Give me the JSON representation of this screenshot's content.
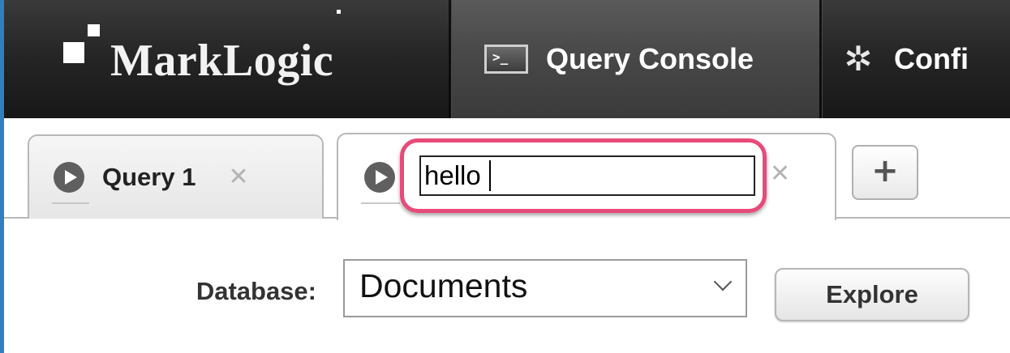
{
  "header": {
    "logo_text": "MarkLogic",
    "nav": [
      {
        "label": "Query Console",
        "icon": "console-icon",
        "active": true
      },
      {
        "label": "Confi",
        "icon": "gear-icon",
        "active": false
      }
    ]
  },
  "tabs": {
    "items": [
      {
        "label": "Query 1",
        "active": false
      },
      {
        "label": "",
        "active": true,
        "editing": true
      }
    ],
    "rename_value": "hello",
    "add_label": "+"
  },
  "database": {
    "label": "Database:",
    "selected": "Documents",
    "explore_label": "Explore"
  },
  "colors": {
    "highlight": "#e84a7a",
    "topbar": "#262626",
    "left_accent": "#2f7fc1"
  }
}
